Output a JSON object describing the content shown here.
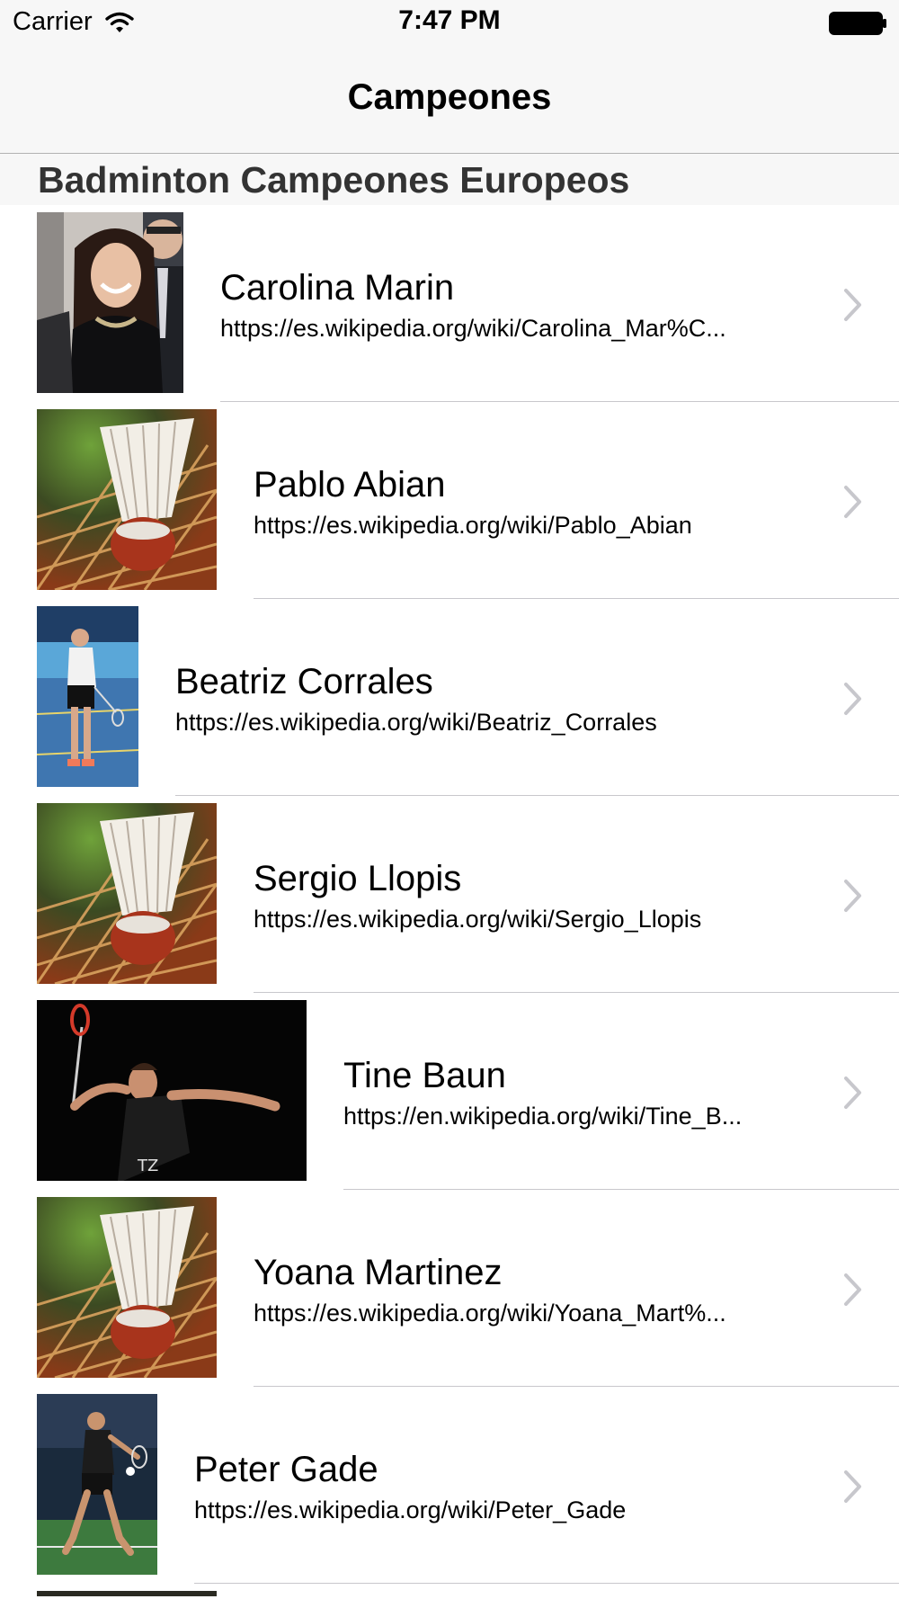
{
  "status_bar": {
    "carrier": "Carrier",
    "time": "7:47 PM"
  },
  "nav": {
    "title": "Campeones"
  },
  "section": {
    "title": "Badminton Campeones Europeos"
  },
  "rows": [
    {
      "name": "Carolina Marin",
      "url": "https://es.wikipedia.org/wiki/Carolina_Mar%C...",
      "thumb": "portrait-photo"
    },
    {
      "name": "Pablo Abian",
      "url": "https://es.wikipedia.org/wiki/Pablo_Abian",
      "thumb": "shuttlecock-photo"
    },
    {
      "name": "Beatriz Corrales",
      "url": "https://es.wikipedia.org/wiki/Beatriz_Corrales",
      "thumb": "player-court-photo"
    },
    {
      "name": "Sergio Llopis",
      "url": "https://es.wikipedia.org/wiki/Sergio_Llopis",
      "thumb": "shuttlecock-photo"
    },
    {
      "name": "Tine Baun",
      "url": "https://en.wikipedia.org/wiki/Tine_B...",
      "thumb": "player-action-photo"
    },
    {
      "name": "Yoana Martinez",
      "url": "https://es.wikipedia.org/wiki/Yoana_Mart%...",
      "thumb": "shuttlecock-photo"
    },
    {
      "name": "Peter Gade",
      "url": "https://es.wikipedia.org/wiki/Peter_Gade",
      "thumb": "player-jump-photo"
    }
  ],
  "colors": {
    "bar_background": "#f7f7f7",
    "separator": "#c8c7cc",
    "chevron": "#c7c7cc",
    "section_text": "#333333"
  }
}
